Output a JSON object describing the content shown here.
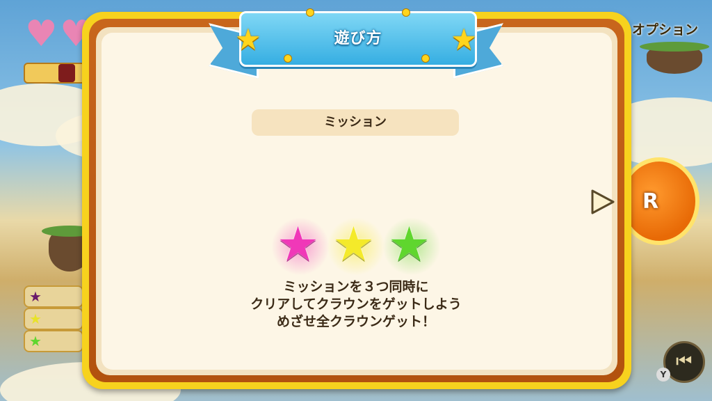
{
  "background": {
    "option_label": "オプション",
    "r_button_label": "R",
    "y_badge_label": "Y"
  },
  "dialog": {
    "title": "遊び方",
    "section_label": "ミッション",
    "stars": [
      {
        "name": "pink-star",
        "color": "#f038b8"
      },
      {
        "name": "yellow-star",
        "color": "#f4ea2a"
      },
      {
        "name": "green-star",
        "color": "#5fd62e"
      }
    ],
    "description_lines": [
      "ミッションを３つ同時に",
      "クリアしてクラウンをゲットしよう",
      "めざせ全クラウンゲット！"
    ]
  },
  "colors": {
    "frame_yellow": "#f7d21e",
    "frame_brown": "#c8661c",
    "panel": "#fdf6e6",
    "banner_blue": "#36aee2",
    "text": "#3b2a16"
  }
}
